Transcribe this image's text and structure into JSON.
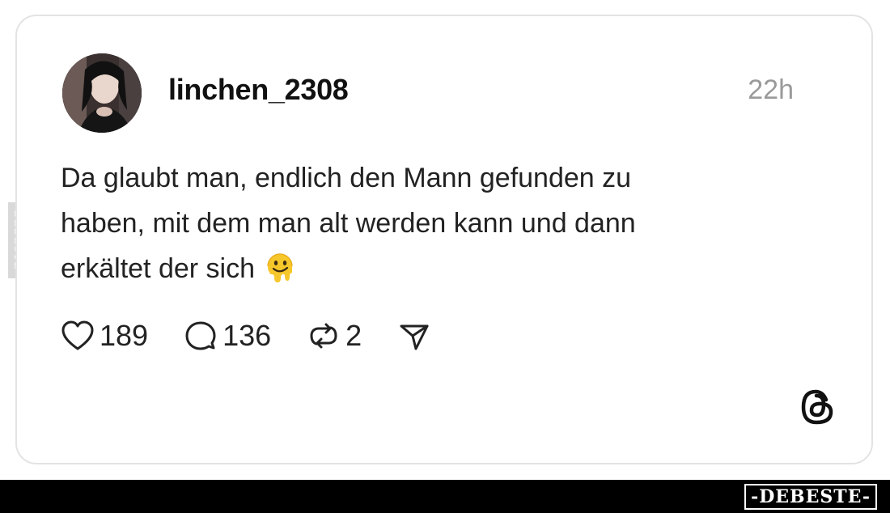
{
  "post": {
    "username": "linchen_2308",
    "timestamp": "22h",
    "text_lines": [
      "Da glaubt man, endlich den Mann gefunden zu",
      "haben, mit dem man alt werden kann und dann",
      "erkältet der sich"
    ],
    "emoji": "melting-face-emoji"
  },
  "actions": {
    "likes": "189",
    "replies": "136",
    "reposts": "2"
  },
  "icons": {
    "like": "heart-icon",
    "reply": "comment-icon",
    "repost": "repost-icon",
    "share": "share-icon",
    "logo": "threads-logo-icon"
  },
  "watermark": {
    "side": "DEBESTE",
    "brand": "-DEBESTE-"
  },
  "colors": {
    "text": "#222222",
    "muted": "#9a9a9a",
    "border": "#e3e3e3",
    "bar": "#000000"
  }
}
